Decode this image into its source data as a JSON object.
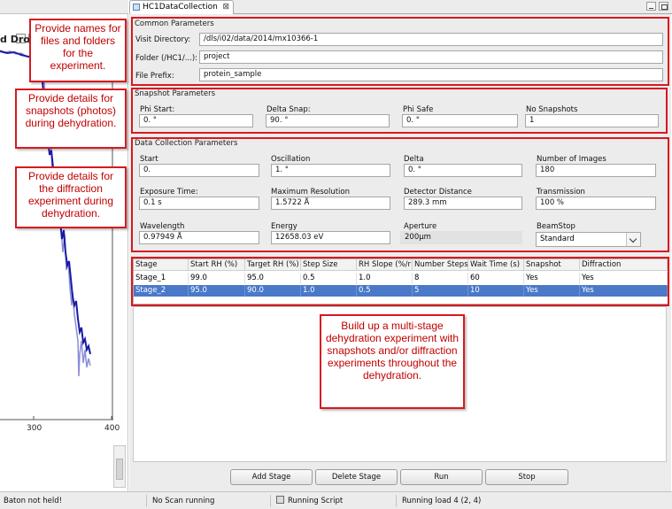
{
  "left_panel": {
    "title": "d Drop",
    "x_ticks": [
      "300",
      "400"
    ]
  },
  "tab": {
    "title": "HC1DataCollection",
    "close_glyph": "⊠"
  },
  "common": {
    "group_title": "Common Parameters",
    "visit_label": "Visit Directory:",
    "visit_value": "/dls/i02/data/2014/mx10366-1",
    "folder_label": "Folder (/HC1/...):",
    "folder_value": "project",
    "prefix_label": "File Prefix:",
    "prefix_value": "protein_sample"
  },
  "snapshot": {
    "group_title": "Snapshot Parameters",
    "phi_start_label": "Phi Start:",
    "phi_start_value": "0. °",
    "delta_snap_label": "Delta Snap:",
    "delta_snap_value": "90. °",
    "phi_safe_label": "Phi Safe",
    "phi_safe_value": "0. °",
    "no_snap_label": "No Snapshots",
    "no_snap_value": "1"
  },
  "collection": {
    "group_title": "Data Collection Parameters",
    "start_label": "Start",
    "start_value": "0.",
    "osc_label": "Oscillation",
    "osc_value": "1. °",
    "delta_label": "Delta",
    "delta_value": "0. °",
    "nimg_label": "Number of Images",
    "nimg_value": "180",
    "exp_label": "Exposure Time:",
    "exp_value": "0.1 s",
    "res_label": "Maximum Resolution",
    "res_value": "1.5722 Å",
    "det_label": "Detector Distance",
    "det_value": "289.3 mm",
    "trans_label": "Transmission",
    "trans_value": "100 %",
    "wl_label": "Wavelength",
    "wl_value": "0.97949 Å",
    "energy_label": "Energy",
    "energy_value": "12658.03 eV",
    "aperture_label": "Aperture",
    "aperture_value": "200μm",
    "beamstop_label": "BeamStop",
    "beamstop_value": "Standard"
  },
  "table": {
    "headers": [
      "Stage",
      "Start RH (%)",
      "Target RH (%)",
      "Step Size",
      "RH Slope (%/r",
      "Number Steps",
      "Wait Time (s)",
      "Snapshot",
      "Diffraction"
    ],
    "rows": [
      [
        "Stage_1",
        "99.0",
        "95.0",
        "0.5",
        "1.0",
        "8",
        "60",
        "Yes",
        "Yes"
      ],
      [
        "Stage_2",
        "95.0",
        "90.0",
        "1.0",
        "0.5",
        "5",
        "10",
        "Yes",
        "Yes"
      ]
    ]
  },
  "buttons": {
    "add": "Add Stage",
    "delete": "Delete Stage",
    "run": "Run",
    "stop": "Stop"
  },
  "status": {
    "baton": "Baton not held!",
    "scan": "No Scan running",
    "script": "Running Script",
    "load": "Running load 4 (2, 4)"
  },
  "callouts": {
    "names": "Provide names for files and folders for the experiment.",
    "snapshots": "Provide details for snapshots (photos) during dehydration.",
    "diffraction": "Provide details for the diffraction experiment during dehydration.",
    "multistage": "Build up a multi-stage dehydration experiment with snapshots and/or diffraction experiments throughout the dehydration."
  },
  "colors": {
    "annotation_red": "#d71920",
    "selection_blue": "#4a79c9",
    "plot_line": "#1a1aa6"
  }
}
